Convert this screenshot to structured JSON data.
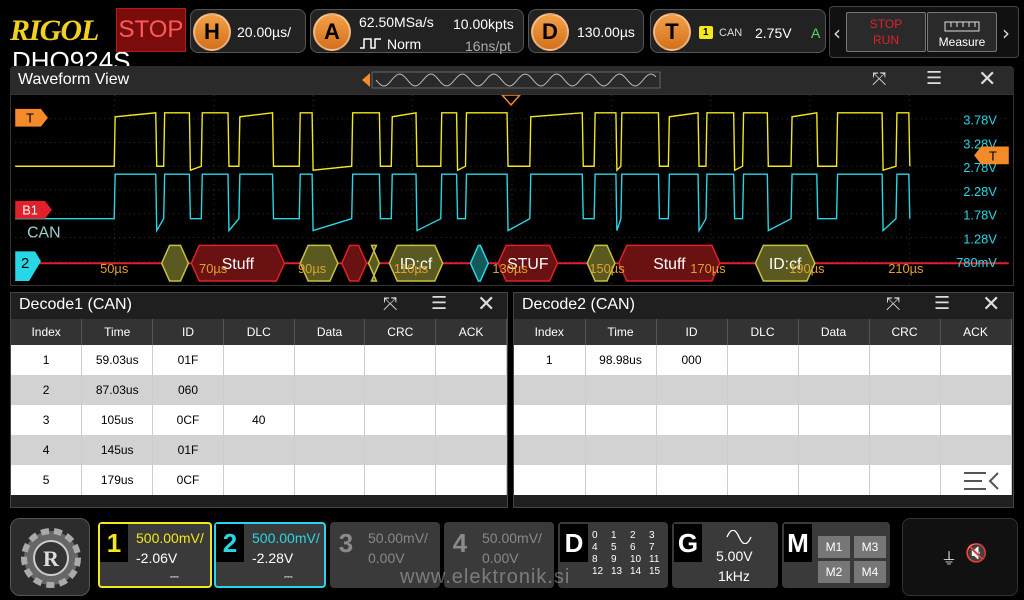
{
  "app": {
    "brand": "RIGOL",
    "model": "DHO924S",
    "run_state": "STOP"
  },
  "horizontal": {
    "badge": "H",
    "timebase": "20.00µs/"
  },
  "acquire": {
    "badge": "A",
    "sample_rate": "62.50MSa/s",
    "memory_depth": "10.00kpts",
    "mode": "Norm",
    "resolution": "16ns/pt"
  },
  "delay": {
    "badge": "D",
    "value": "130.00µs"
  },
  "trigger": {
    "badge": "T",
    "source_channel": "1",
    "type": "CAN",
    "level": "2.75V",
    "mode": "A"
  },
  "controls": {
    "stop_label": "STOP",
    "run_label": "RUN",
    "measure_label": "Measure"
  },
  "waveform_view": {
    "title": "Waveform View",
    "marker_T": "T",
    "marker_B1": "B1",
    "marker_CAN": "CAN",
    "marker_ch2": "2",
    "trigger_right_marker": "T",
    "time_labels": [
      "50µs",
      "70µs",
      "90µs",
      "110µs",
      "130µs",
      "150µs",
      "170µs",
      "190µs",
      "210µs"
    ],
    "voltage_labels": [
      "3.78V",
      "3.28V",
      "2.78V",
      "2.28V",
      "1.78V",
      "1.28V",
      "780mV"
    ],
    "bus_labels": [
      "Stuff",
      "ID:cf",
      "STUF",
      "Stuff",
      "ID:cf"
    ],
    "colors": {
      "ch1": "#f2e81c",
      "ch2": "#28d7e6",
      "bus_red": "#e0202a",
      "bus_olive": "#8a8a2a",
      "marker_orange": "#f58a2a"
    }
  },
  "decode1": {
    "title": "Decode1 (CAN)",
    "columns": [
      "Index",
      "Time",
      "ID",
      "DLC",
      "Data",
      "CRC",
      "ACK"
    ],
    "rows": [
      [
        "1",
        "59.03us",
        "01F",
        "",
        "",
        "",
        ""
      ],
      [
        "2",
        "87.03us",
        "060",
        "",
        "",
        "",
        ""
      ],
      [
        "3",
        "105us",
        "0CF",
        "40",
        "",
        "",
        ""
      ],
      [
        "4",
        "145us",
        "01F",
        "",
        "",
        "",
        ""
      ],
      [
        "5",
        "179us",
        "0CF",
        "",
        "",
        "",
        ""
      ]
    ]
  },
  "decode2": {
    "title": "Decode2 (CAN)",
    "columns": [
      "Index",
      "Time",
      "ID",
      "DLC",
      "Data",
      "CRC",
      "ACK"
    ],
    "rows": [
      [
        "1",
        "98.98us",
        "000",
        "",
        "",
        "",
        ""
      ],
      [
        "",
        "",
        "",
        "",
        "",
        "",
        ""
      ],
      [
        "",
        "",
        "",
        "",
        "",
        "",
        ""
      ],
      [
        "",
        "",
        "",
        "",
        "",
        "",
        ""
      ],
      [
        "",
        "",
        "",
        "",
        "",
        "",
        ""
      ]
    ]
  },
  "channels": [
    {
      "num": "1",
      "scale": "500.00mV/",
      "offset": "-2.06V",
      "color": "#f2e81c"
    },
    {
      "num": "2",
      "scale": "500.00mV/",
      "offset": "-2.28V",
      "color": "#28d7e6"
    },
    {
      "num": "3",
      "scale": "50.00mV/",
      "offset": "0.00V",
      "color": "#8a8a8a"
    },
    {
      "num": "4",
      "scale": "50.00mV/",
      "offset": "0.00V",
      "color": "#8a8a8a"
    }
  ],
  "digital": {
    "label": "D",
    "bits": [
      "0",
      "1",
      "2",
      "3",
      "4",
      "5",
      "6",
      "7",
      "8",
      "9",
      "10",
      "11",
      "12",
      "13",
      "14",
      "15"
    ]
  },
  "generator": {
    "label": "G",
    "amplitude": "5.00V",
    "frequency": "1kHz"
  },
  "math": {
    "label": "M",
    "items": [
      "M1",
      "M3",
      "M2",
      "M4"
    ]
  },
  "watermark": "www.elektronik.si"
}
